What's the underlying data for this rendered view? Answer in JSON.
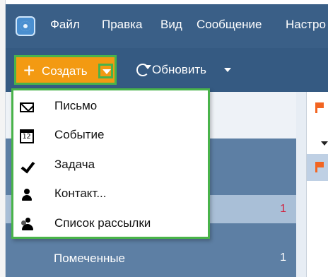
{
  "menubar": {
    "items": [
      "Файл",
      "Правка",
      "Вид",
      "Сообщение",
      "Настро"
    ]
  },
  "toolbar": {
    "create_label": "Создать",
    "plus_symbol": "+",
    "refresh_label": "Обновить"
  },
  "create_menu": {
    "items": [
      {
        "label": "Письмо",
        "icon": "envelope-icon"
      },
      {
        "label": "Событие",
        "icon": "calendar-icon",
        "icon_text": "12"
      },
      {
        "label": "Задача",
        "icon": "check-icon"
      },
      {
        "label": "Контакт...",
        "icon": "person-icon"
      },
      {
        "label": "Список рассылки",
        "icon": "group-icon"
      }
    ]
  },
  "folders": {
    "selected_count": "1",
    "starred_label": "Помеченные",
    "starred_count": "1"
  },
  "colors": {
    "accent": "#f39a12",
    "highlight_border": "#49b34a",
    "header_bg": "#3a5f87",
    "folder_pane_bg": "#5d7fa4",
    "flag": "#f26522",
    "unread_count": "#d21f3c"
  }
}
